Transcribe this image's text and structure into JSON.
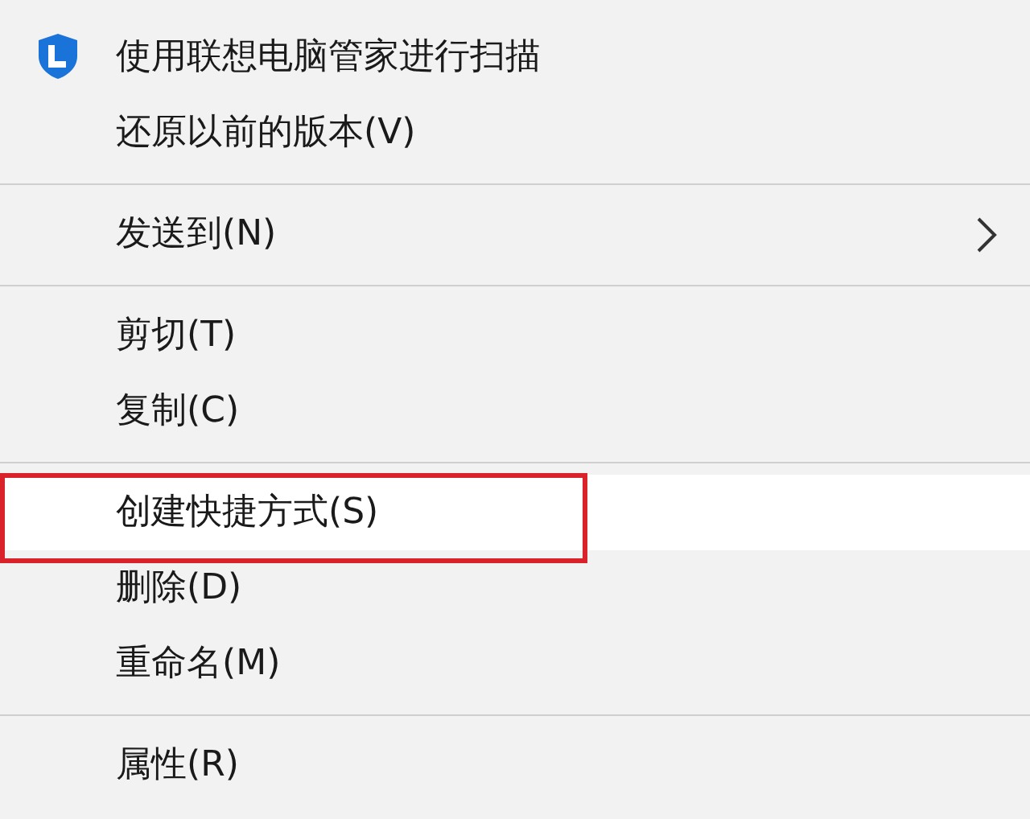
{
  "menu": {
    "groups": [
      {
        "items": [
          {
            "label": "使用联想电脑管家进行扫描",
            "kind": "icon",
            "selected": false
          },
          {
            "label": "还原以前的版本(V)",
            "kind": "plain",
            "selected": false
          }
        ]
      },
      {
        "items": [
          {
            "label": "发送到(N)",
            "kind": "submenu",
            "selected": false
          }
        ]
      },
      {
        "items": [
          {
            "label": "剪切(T)",
            "kind": "plain",
            "selected": false
          },
          {
            "label": "复制(C)",
            "kind": "plain",
            "selected": false
          }
        ]
      },
      {
        "items": [
          {
            "label": "创建快捷方式(S)",
            "kind": "plain",
            "selected": true
          },
          {
            "label": "删除(D)",
            "kind": "plain",
            "selected": false
          },
          {
            "label": "重命名(M)",
            "kind": "plain",
            "selected": false
          }
        ]
      },
      {
        "items": [
          {
            "label": "属性(R)",
            "kind": "plain",
            "selected": false
          }
        ]
      }
    ]
  }
}
